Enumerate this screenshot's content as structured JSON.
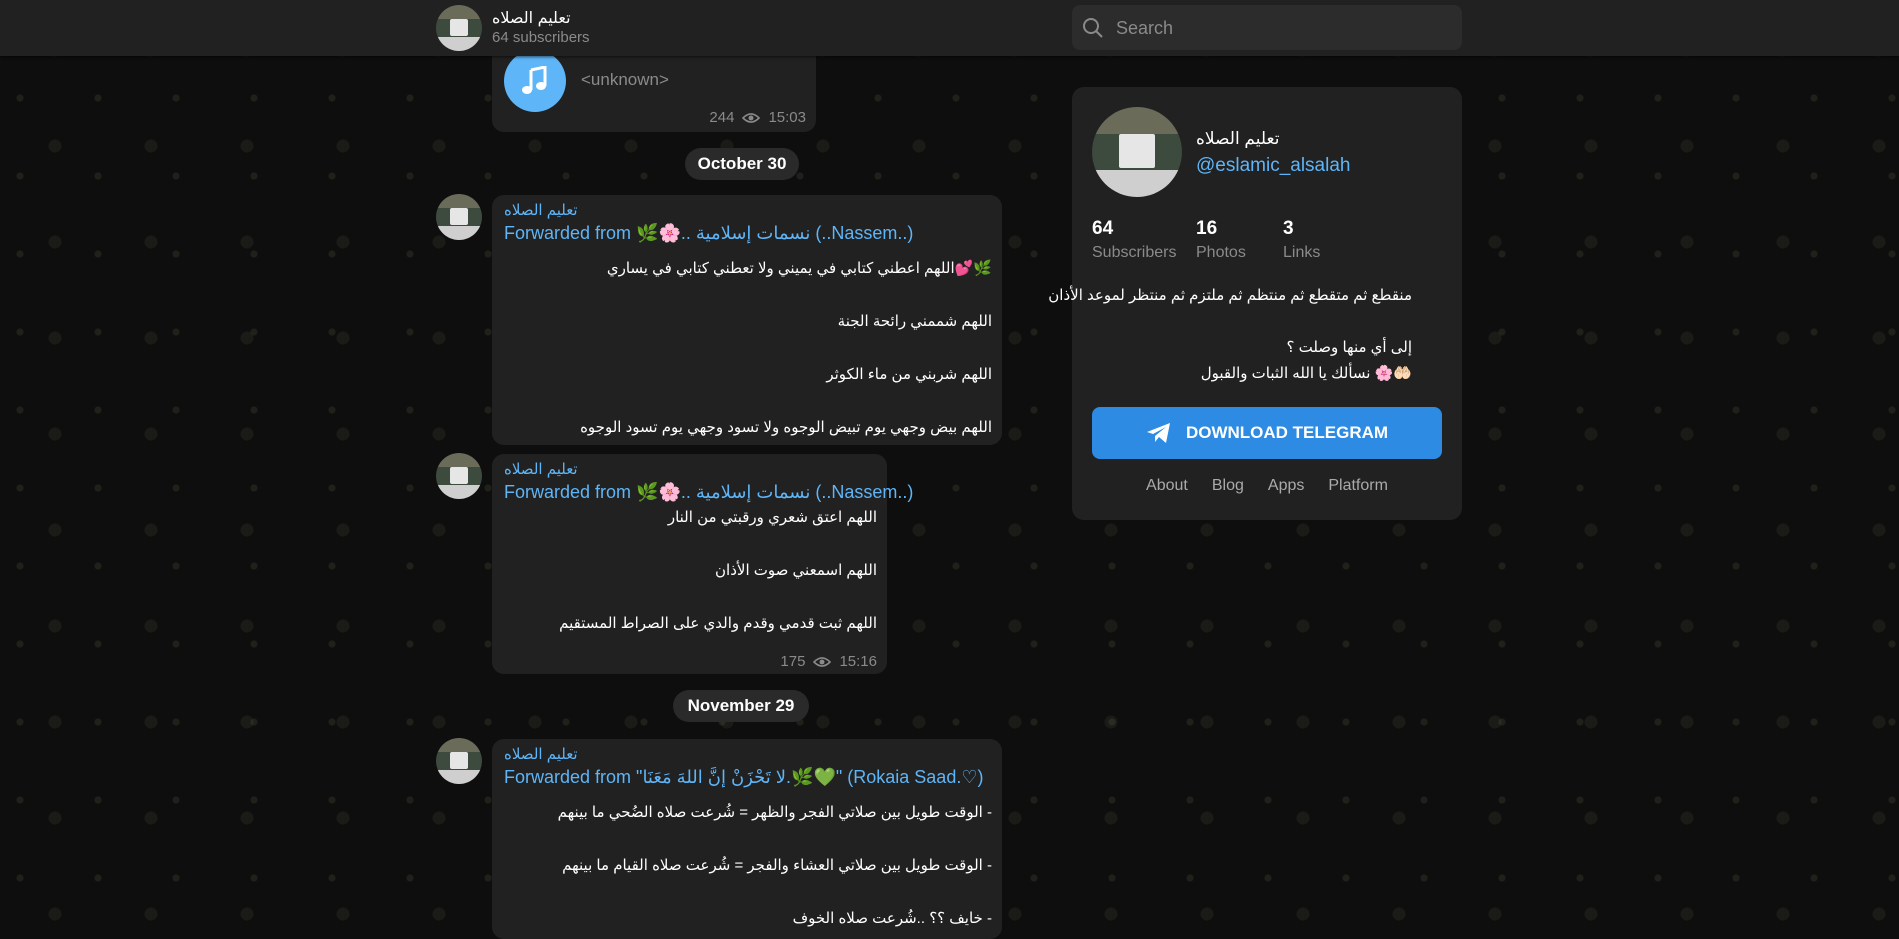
{
  "header": {
    "channel_title": "تعليم الصلاه",
    "subscribers": "64 subscribers",
    "search_placeholder": "Search"
  },
  "audio_message": {
    "performer": "<unknown>",
    "views": "244",
    "time": "15:03",
    "icon": "music-note-icon"
  },
  "dates": [
    "October 30",
    "November 29"
  ],
  "messages": [
    {
      "author": "تعليم الصلاه",
      "forwarded_from": "Forwarded from 🌿🌸.. نسمات إسلامية (..Nassem..)",
      "lines": [
        "🌿💕اللهم اعطني كتابي في يميني ولا تعطني كتابي في يساري",
        "",
        "اللهم شممني رائحة الجنة",
        "",
        "اللهم شربني من ماء الكوثر",
        "",
        "اللهم بيض وجهي يوم تبيض الوجوه ولا تسود وجهي يوم تسود الوجوه"
      ]
    },
    {
      "author": "تعليم الصلاه",
      "forwarded_from": "Forwarded from 🌿🌸.. نسمات إسلامية (..Nassem..)",
      "lines": [
        "اللهم اعتق شعري ورقبتي من النار",
        "",
        "اللهم اسمعني صوت الأذان",
        "",
        "اللهم ثبت قدمي وقدم والدي على الصراط المستقيم"
      ],
      "views": "175",
      "time": "15:16"
    },
    {
      "author": "تعليم الصلاه",
      "forwarded_from": "Forwarded from \"لا تَحْزَنْ إنَّ اللهَ مَعَنَا.🌿💚\" (Rokaia Saad.♡)",
      "lines": [
        "- الوقت طويل بين صلاتي الفجر والظهر = شُرعت صلاه الضُحي ما بينهم",
        "",
        "- الوقت طويل بين صلاتي العشاء والفجر = شُرعت صلاه القيام ما بينهم",
        "",
        "- خايف ؟؟ ..شُرعت صلاه الخوف"
      ]
    }
  ],
  "channel_card": {
    "name": "تعليم الصلاه",
    "handle": "@eslamic_alsalah",
    "stats": [
      {
        "value": "64",
        "label": "Subscribers"
      },
      {
        "value": "16",
        "label": "Photos"
      },
      {
        "value": "3",
        "label": "Links"
      }
    ],
    "description": [
      "منقطع ثم متقطع ثم منتظم ثم ملتزم ثم منتظر لموعد الأذان",
      "",
      "إلى أي منها وصلت ؟",
      "🤲🏻🌸 نسألك يا الله الثبات والقبول"
    ],
    "download_button": "DOWNLOAD TELEGRAM",
    "footer_links": [
      "About",
      "Blog",
      "Apps",
      "Platform"
    ]
  },
  "colors": {
    "accent": "#5eb5f7",
    "button": "#2d8be3",
    "bubble": "#212121",
    "background": "#0e0e0e"
  }
}
